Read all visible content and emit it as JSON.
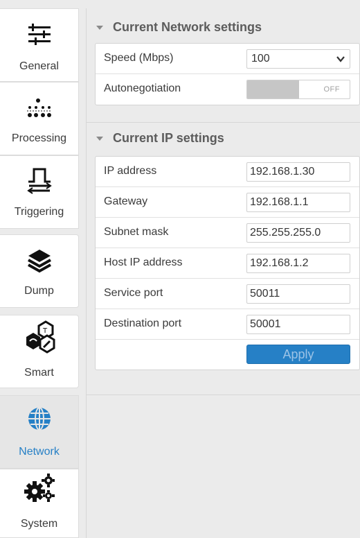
{
  "sidebar": {
    "items": [
      {
        "label": "General",
        "icon": "sliders-icon"
      },
      {
        "label": "Processing",
        "icon": "dots-icon"
      },
      {
        "label": "Triggering",
        "icon": "pulse-icon"
      },
      {
        "label": "Dump",
        "icon": "layers-icon"
      },
      {
        "label": "Smart",
        "icon": "smart-icon"
      },
      {
        "label": "Network",
        "icon": "globe-icon",
        "active": true
      },
      {
        "label": "System",
        "icon": "gears-icon"
      }
    ]
  },
  "network_section": {
    "title": "Current Network settings",
    "speed_label": "Speed (Mbps)",
    "speed_value": "100",
    "autoneg_label": "Autonegotiation",
    "autoneg_state": "OFF"
  },
  "ip_section": {
    "title": "Current IP settings",
    "rows": [
      {
        "label": "IP address",
        "value": "192.168.1.30"
      },
      {
        "label": "Gateway",
        "value": "192.168.1.1"
      },
      {
        "label": "Subnet mask",
        "value": "255.255.255.0"
      },
      {
        "label": "Host IP address",
        "value": "192.168.1.2"
      },
      {
        "label": "Service port",
        "value": "50011"
      },
      {
        "label": "Destination port",
        "value": "50001"
      }
    ],
    "apply_label": "Apply"
  },
  "colors": {
    "accent": "#2680c6",
    "active_label": "#2680c6",
    "icon": "#111111"
  }
}
